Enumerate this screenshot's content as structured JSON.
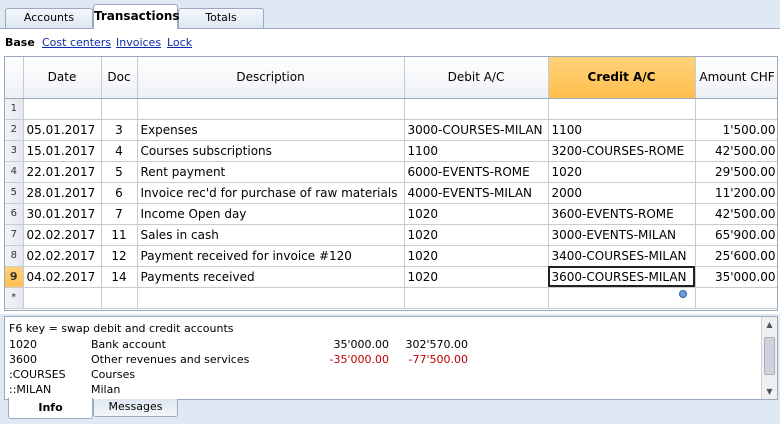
{
  "top_tabs": [
    "Accounts",
    "Transactions",
    "Totals"
  ],
  "subnav": {
    "base": "Base",
    "links": [
      "Cost centers",
      "Invoices",
      "Lock"
    ]
  },
  "columns": {
    "date": "Date",
    "doc": "Doc",
    "description": "Description",
    "debit": "Debit A/C",
    "credit": "Credit A/C",
    "amount": "Amount CHF"
  },
  "rows": [
    {
      "n": "1",
      "date": "",
      "doc": "",
      "description": "",
      "debit": "",
      "credit": "",
      "amount": ""
    },
    {
      "n": "2",
      "date": "05.01.2017",
      "doc": "3",
      "description": "Expenses",
      "debit": "3000-COURSES-MILAN",
      "credit": "1100",
      "amount": "1'500.00"
    },
    {
      "n": "3",
      "date": "15.01.2017",
      "doc": "4",
      "description": "Courses subscriptions",
      "debit": "1100",
      "credit": "3200-COURSES-ROME",
      "amount": "42'500.00"
    },
    {
      "n": "4",
      "date": "22.01.2017",
      "doc": "5",
      "description": "Rent payment",
      "debit": "6000-EVENTS-ROME",
      "credit": "1020",
      "amount": "29'500.00"
    },
    {
      "n": "5",
      "date": "28.01.2017",
      "doc": "6",
      "description": "Invoice rec'd for purchase of raw materials",
      "debit": "4000-EVENTS-MILAN",
      "credit": "2000",
      "amount": "11'200.00"
    },
    {
      "n": "6",
      "date": "30.01.2017",
      "doc": "7",
      "description": "Income Open day",
      "debit": "1020",
      "credit": "3600-EVENTS-ROME",
      "amount": "42'500.00"
    },
    {
      "n": "7",
      "date": "02.02.2017",
      "doc": "11",
      "description": "Sales in cash",
      "debit": "1020",
      "credit": "3000-EVENTS-MILAN",
      "amount": "65'900.00"
    },
    {
      "n": "8",
      "date": "02.02.2017",
      "doc": "12",
      "description": "Payment received for invoice #120",
      "debit": "1020",
      "credit": "3400-COURSES-MILAN",
      "amount": "25'600.00"
    },
    {
      "n": "9",
      "date": "04.02.2017",
      "doc": "14",
      "description": "Payments received",
      "debit": "1020",
      "credit": "3600-COURSES-MILAN",
      "amount": "35'000.00"
    },
    {
      "n": "*",
      "date": "",
      "doc": "",
      "description": "",
      "debit": "",
      "credit": "",
      "amount": ""
    }
  ],
  "info": {
    "hint": "F6 key = swap debit and credit accounts",
    "lines": [
      {
        "code": "1020",
        "name": "Bank account",
        "v1": "35'000.00",
        "v2": "302'570.00"
      },
      {
        "code": "3600",
        "name": "Other revenues and services",
        "v1": "-35'000.00",
        "v2": "-77'500.00"
      },
      {
        "code": ":COURSES",
        "name": "Courses",
        "v1": "",
        "v2": ""
      },
      {
        "code": "::MILAN",
        "name": "Milan",
        "v1": "",
        "v2": ""
      }
    ]
  },
  "bottom_tabs": [
    "Info",
    "Messages"
  ]
}
